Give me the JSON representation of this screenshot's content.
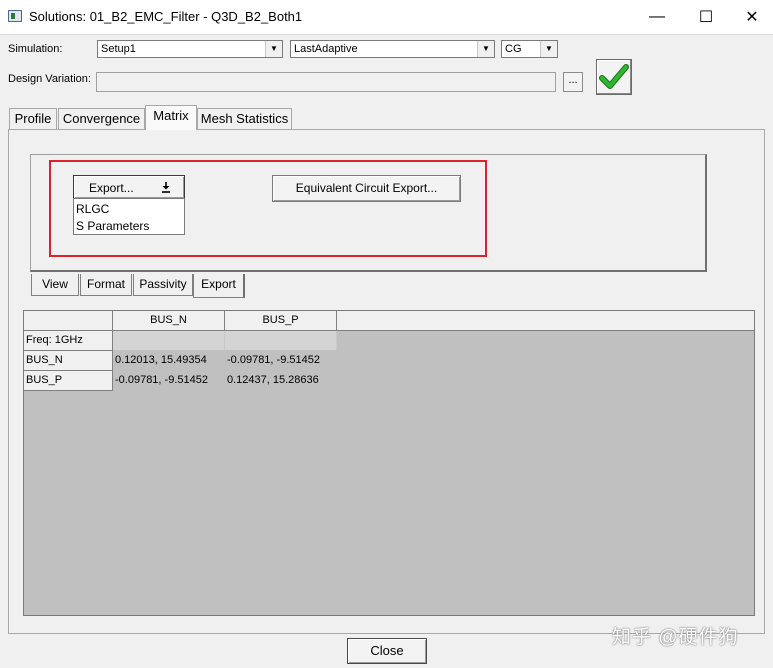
{
  "window": {
    "title": "Solutions: 01_B2_EMC_Filter - Q3D_B2_Both1",
    "minimize": "—",
    "maximize": "☐",
    "close": "✕"
  },
  "simulation": {
    "label": "Simulation:",
    "setup": "Setup1",
    "pass": "LastAdaptive",
    "type": "CG"
  },
  "design_variation": {
    "label": "Design Variation:",
    "value": "",
    "browse_label": "..."
  },
  "tabs": [
    "Profile",
    "Convergence",
    "Matrix",
    "Mesh Statistics"
  ],
  "active_tab": "Matrix",
  "export": {
    "button_label": "Export...",
    "menu": [
      "RLGC",
      "S Parameters"
    ],
    "equivalent_circuit_label": "Equivalent Circuit Export...",
    "highlight_color": "#d9232d"
  },
  "subtabs": [
    "View",
    "Format",
    "Passivity",
    "Export"
  ],
  "active_subtab": "Export",
  "grid": {
    "columns": [
      "BUS_N",
      "BUS_P"
    ],
    "freq_label": "Freq: 1GHz",
    "rows": [
      {
        "name": "BUS_N",
        "values": [
          "0.12013, 15.49354",
          "-0.09781, -9.51452"
        ]
      },
      {
        "name": "BUS_P",
        "values": [
          "-0.09781, -9.51452",
          "0.12437, 15.28636"
        ]
      }
    ]
  },
  "close_label": "Close",
  "watermark": "知乎 @硬件狗",
  "check_color": "#2fb82f"
}
